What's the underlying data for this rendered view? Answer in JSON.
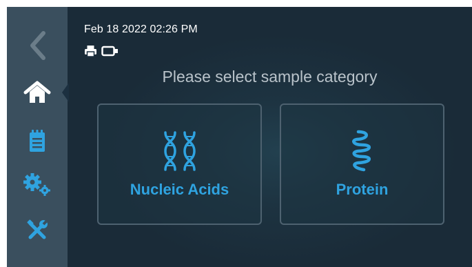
{
  "status": {
    "datetime": "Feb 18 2022 02:26 PM",
    "icons": [
      "printer-icon",
      "usb-drive-icon"
    ]
  },
  "sidebar": {
    "items": [
      {
        "name": "back",
        "icon": "chevron-left-icon",
        "enabled": false
      },
      {
        "name": "home",
        "icon": "home-icon",
        "active": true
      },
      {
        "name": "notes",
        "icon": "notepad-icon"
      },
      {
        "name": "settings",
        "icon": "gears-icon"
      },
      {
        "name": "tools",
        "icon": "tools-icon"
      }
    ]
  },
  "main": {
    "prompt": "Please select sample category",
    "categories": [
      {
        "label": "Nucleic Acids",
        "icon": "dna-icon"
      },
      {
        "label": "Protein",
        "icon": "protein-helix-icon"
      }
    ]
  },
  "colors": {
    "accent": "#2fa3e0",
    "sidebar": "#3a4f5e",
    "background": "#1a2b38"
  }
}
